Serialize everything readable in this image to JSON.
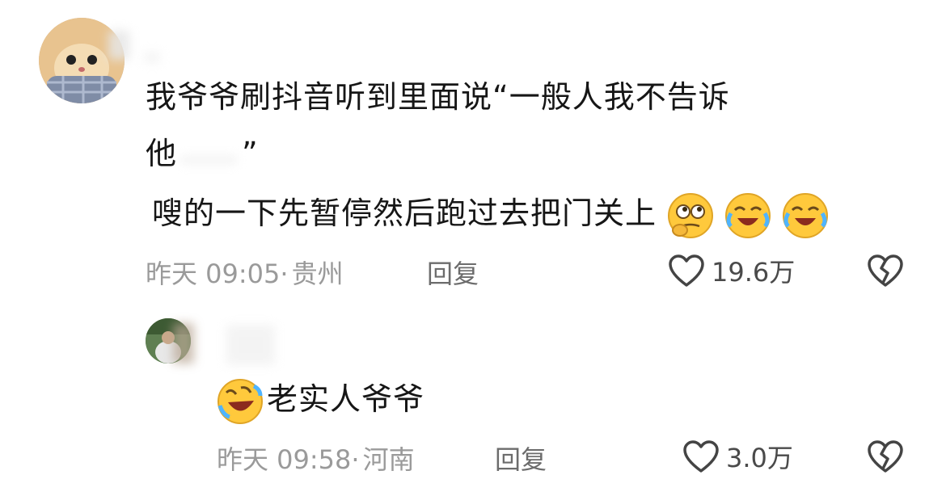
{
  "comment": {
    "line1": "我爷爷刷抖音听到里面说“一般人我不告诉",
    "line2_start": "他",
    "line2_end": "”",
    "line3": "嗖的一下先暂停然后跑过去把门关上",
    "emojis": [
      "thinking-face-icon",
      "laugh-cry-icon",
      "laugh-cry-icon"
    ],
    "meta": {
      "time": "昨天 09:05",
      "separator": "·",
      "location": "贵州"
    },
    "reply_label": "回复",
    "likes": "19.6万"
  },
  "reply": {
    "text": "老实人爷爷",
    "emoji": "rofl-icon",
    "meta": {
      "time": "昨天 09:58",
      "separator": "·",
      "location": "河南"
    },
    "reply_label": "回复",
    "likes": "3.0万"
  },
  "colors": {
    "meta_text": "#9a9a9a",
    "reply_text": "#6c6c6c",
    "body_text": "#161616",
    "emoji_yellow": "#ffc93c"
  }
}
